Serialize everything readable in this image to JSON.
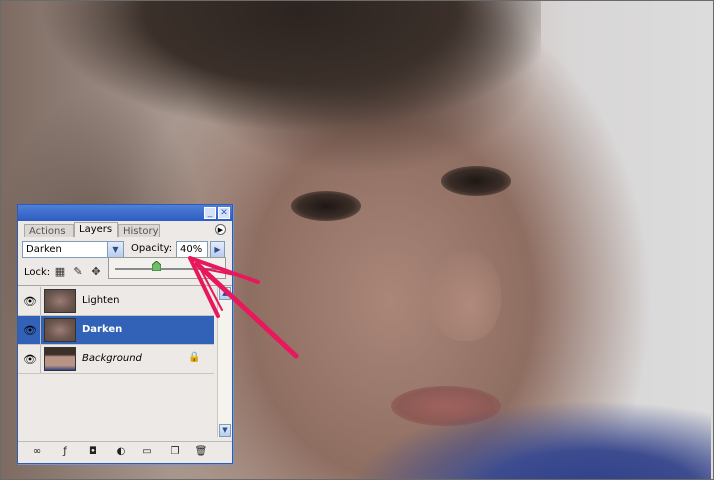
{
  "panel": {
    "tabs": [
      {
        "label": "Actions"
      },
      {
        "label": "Layers"
      },
      {
        "label": "History"
      }
    ],
    "blend_mode": "Darken",
    "opacity_label": "Opacity:",
    "opacity_value": "40%",
    "opacity_fraction": 0.4,
    "lock_label": "Lock:",
    "layers": [
      {
        "name": "Lighten",
        "visible": true,
        "selected": false
      },
      {
        "name": "Darken",
        "visible": true,
        "selected": true
      },
      {
        "name": "Background",
        "visible": true,
        "selected": false,
        "locked": true
      }
    ]
  },
  "icons": {
    "eye": "eye-icon",
    "lock": "lock-icon",
    "link": "link-layers-icon",
    "fx": "layer-style-icon",
    "mask": "layer-mask-icon",
    "adjust": "adjustment-layer-icon",
    "folder": "new-group-icon",
    "new": "new-layer-icon",
    "trash": "trash-icon"
  },
  "colors": {
    "selection": "#3162b7",
    "titlebar": "#2d5cc2",
    "arrow": "#e8185c"
  }
}
